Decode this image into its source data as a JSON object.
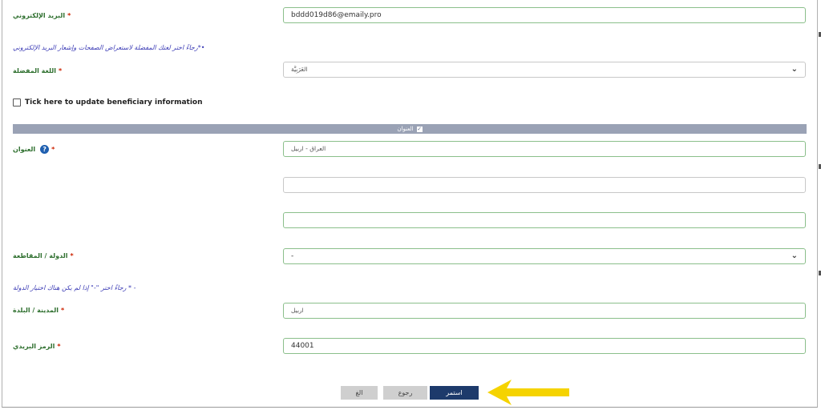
{
  "form": {
    "email": {
      "label": "البريد الإلكتروني",
      "required": "*",
      "value": "bddd019d86@emaily.pro"
    },
    "notes": {
      "language_note": "رجاءً اختر لغتك المفضلة لاستعراض الصفحات وإشعار البريد الإلكتروني*•",
      "country_note": "رجاءً اختر \"-\" إذا لم يكن هناك اختيار الدولة * -"
    },
    "language": {
      "label": "اللغة المفضلة",
      "required": "*",
      "selected": "العَرَبِيَّة"
    },
    "beneficiary_checkbox": {
      "label": "Tick here to update beneficiary information",
      "checked": false
    },
    "address_section": {
      "title": "العنوان"
    },
    "address": {
      "label": "العنوان",
      "required": "*",
      "help_icon": "question-icon",
      "line1": "العراق - اربيل",
      "line2": "",
      "line3": ""
    },
    "country": {
      "label": "الدولة / المقاطعة",
      "required": "*",
      "selected": "-"
    },
    "city": {
      "label": "المدينة / البلدة",
      "required": "*",
      "value": "اربيل"
    },
    "postal": {
      "label": "الرمز البريدي",
      "required": "*",
      "value": "44001"
    }
  },
  "buttons": {
    "cancel": "الغ",
    "back": "رجوع",
    "next": "استمر"
  },
  "colors": {
    "primary_button": "#1d3a6b",
    "label_green": "#2e6f2e",
    "note_blue": "#3b3bb5",
    "arrow_yellow": "#f5d300",
    "section_bar": "#9aa2b5"
  }
}
